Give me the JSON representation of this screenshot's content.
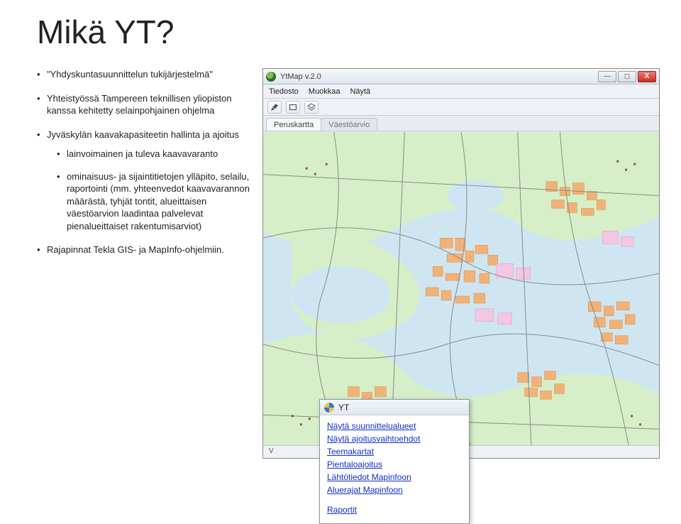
{
  "title": "Mikä YT?",
  "bullets": {
    "b1": "\"Yhdyskuntasuunnittelun tukijärjestelmä\"",
    "b2": "Yhteistyössä Tampereen teknillisen yliopiston kanssa kehitetty selainpohjainen ohjelma",
    "b3": "Jyväskylän kaavakapasiteetin hallinta ja ajoitus",
    "b3a": "lainvoimainen ja tuleva kaavavaranto",
    "b3b": "ominaisuus- ja sijaintitietojen ylläpito, selailu, raportointi (mm. yhteenvedot kaavavarannon määrästä, tyhjät tontit, alueittaisen väestöarvion laadintaa palvelevat pienalueittaiset rakentumisarviot)",
    "b4": "Rajapinnat Tekla GIS- ja MapInfo-ohjelmiin."
  },
  "window": {
    "title": "YtMap v.2.0",
    "minimize_glyph": "—",
    "maximize_glyph": "◻",
    "close_glyph": "X"
  },
  "menubar": {
    "file": "Tiedosto",
    "edit": "Muokkaa",
    "view": "Näytä"
  },
  "tabs": {
    "t1": "Peruskartta",
    "t2": "Väestöarvio"
  },
  "popup": {
    "title": "YT",
    "items": {
      "i1": "Näytä suunnittelualueet",
      "i2": "Näytä ajoitusvaihtoehdot",
      "i3": "Teemakartat",
      "i4": "Pientaloajoitus",
      "i5": "Lähtötiedot Mapinfoon",
      "i6": "Aluerajat Mapinfoon",
      "i7": "Raportit"
    }
  },
  "statusbar": {
    "scale_label": "V"
  }
}
